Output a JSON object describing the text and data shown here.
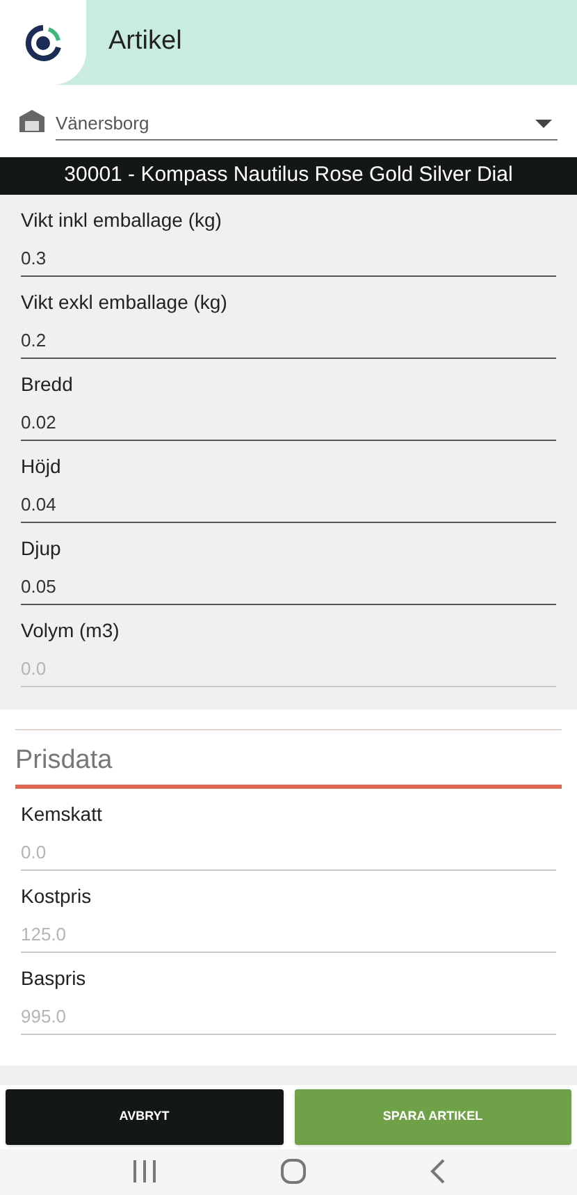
{
  "header": {
    "title": "Artikel"
  },
  "warehouse_select": {
    "value": "Vänersborg"
  },
  "article_title": "30001 - Kompass Nautilus Rose Gold Silver Dial",
  "dimension_fields": [
    {
      "label": "Vikt inkl emballage (kg)",
      "value": "0.3",
      "disabled": false
    },
    {
      "label": "Vikt exkl emballage (kg)",
      "value": "0.2",
      "disabled": false
    },
    {
      "label": "Bredd",
      "value": "0.02",
      "disabled": false
    },
    {
      "label": "Höjd",
      "value": "0.04",
      "disabled": false
    },
    {
      "label": "Djup",
      "value": "0.05",
      "disabled": false
    },
    {
      "label": "Volym (m3)",
      "value": "0.0",
      "disabled": true
    }
  ],
  "price_section": {
    "title": "Prisdata",
    "fields": [
      {
        "label": "Kemskatt",
        "value": "0.0",
        "disabled": true
      },
      {
        "label": "Kostpris",
        "value": "125.0",
        "disabled": true
      },
      {
        "label": "Baspris",
        "value": "995.0",
        "disabled": true
      }
    ]
  },
  "buttons": [
    {
      "label": "AVBRYT",
      "kind": "cancel"
    },
    {
      "label": "SPARA ARTIKEL",
      "kind": "save"
    }
  ]
}
